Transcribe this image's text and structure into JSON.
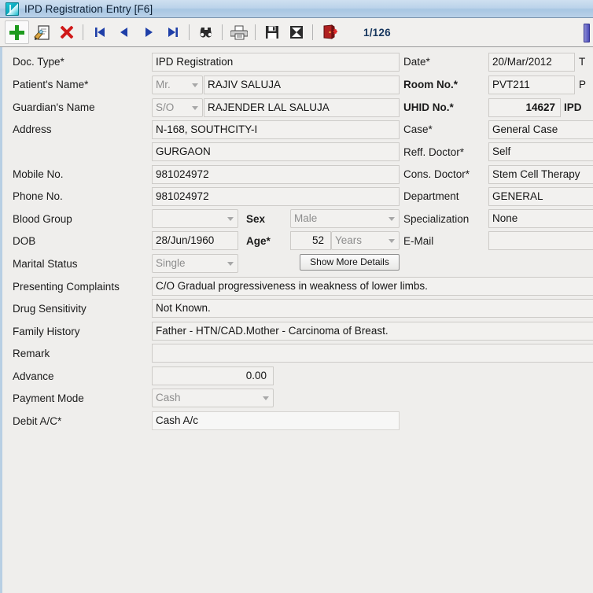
{
  "window": {
    "title": "IPD Registration Entry [F6]",
    "icon": "app-icon"
  },
  "toolbar": {
    "icons": [
      {
        "name": "add-icon",
        "label": "New"
      },
      {
        "name": "edit-document-icon",
        "label": "Edit"
      },
      {
        "name": "delete-icon",
        "label": "Delete"
      },
      {
        "name": "first-record-icon",
        "label": "First"
      },
      {
        "name": "previous-record-icon",
        "label": "Previous"
      },
      {
        "name": "next-record-icon",
        "label": "Next"
      },
      {
        "name": "last-record-icon",
        "label": "Last"
      },
      {
        "name": "find-binoculars-icon",
        "label": "Find"
      },
      {
        "name": "print-icon",
        "label": "Print"
      },
      {
        "name": "save-icon",
        "label": "Save"
      },
      {
        "name": "save-as-icon",
        "label": "Save As"
      },
      {
        "name": "exit-door-icon",
        "label": "Exit"
      }
    ],
    "record_counter": "1/126"
  },
  "form": {
    "left": {
      "doc_type": {
        "label": "Doc. Type*",
        "value": "IPD Registration"
      },
      "patients_name": {
        "label": "Patient's Name*",
        "title": "Mr.",
        "value": "RAJIV SALUJA"
      },
      "guardians_name": {
        "label": "Guardian's Name",
        "relation": "S/O",
        "value": "RAJENDER LAL SALUJA"
      },
      "address": {
        "label": "Address",
        "line1": "N-168, SOUTHCITY-I",
        "line2": "GURGAON"
      },
      "mobile_no": {
        "label": "Mobile No.",
        "value": "981024972"
      },
      "phone_no": {
        "label": "Phone No.",
        "value": "981024972"
      },
      "blood_group": {
        "label": "Blood Group",
        "value": ""
      },
      "sex": {
        "label": "Sex",
        "value": "Male"
      },
      "dob": {
        "label": "DOB",
        "value": "28/Jun/1960"
      },
      "age": {
        "label": "Age*",
        "value": "52",
        "unit": "Years"
      },
      "marital_status": {
        "label": "Marital Status",
        "value": "Single"
      },
      "show_more_details": {
        "label": "Show More Details"
      },
      "presenting_complaints": {
        "label": "Presenting Complaints",
        "value": "C/O Gradual progressiveness in weakness of lower limbs."
      },
      "drug_sensitivity": {
        "label": "Drug Sensitivity",
        "value": "Not Known."
      },
      "family_history": {
        "label": "Family History",
        "value": "Father - HTN/CAD.Mother - Carcinoma of Breast."
      },
      "remark": {
        "label": "Remark",
        "value": ""
      },
      "advance": {
        "label": "Advance",
        "value": "0.00"
      },
      "payment_mode": {
        "label": "Payment Mode",
        "value": "Cash"
      },
      "debit_ac": {
        "label": "Debit A/C*",
        "value": "Cash A/c"
      }
    },
    "right": {
      "date": {
        "label": "Date*",
        "value": "20/Mar/2012",
        "trailing": "T"
      },
      "room_no": {
        "label": "Room No.*",
        "value": "PVT211",
        "trailing": "P"
      },
      "uhid_no": {
        "label": "UHID No.*",
        "value": "14627",
        "trailing": "IPD"
      },
      "case": {
        "label": "Case*",
        "value": "General Case"
      },
      "reff_doctor": {
        "label": "Reff. Doctor*",
        "value": "Self"
      },
      "cons_doctor": {
        "label": "Cons. Doctor*",
        "value": "Stem Cell Therapy"
      },
      "department": {
        "label": "Department",
        "value": "GENERAL"
      },
      "specialization": {
        "label": "Specialization",
        "value": "None"
      },
      "email": {
        "label": "E-Mail",
        "value": ""
      }
    }
  }
}
